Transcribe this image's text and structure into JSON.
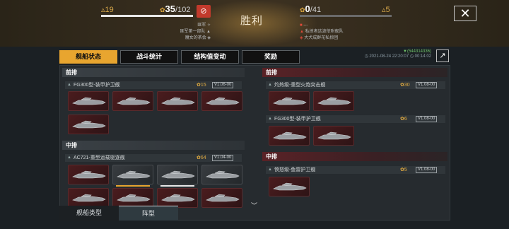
{
  "header": {
    "left_level": "19",
    "left_score": "35",
    "left_score_total": "/102",
    "right_score": "0",
    "right_score_total": "/41",
    "right_level": "5",
    "result": "胜利",
    "left_notes": [
      "匪军",
      "匪军第一部队",
      "魔女的茶会"
    ],
    "right_notes": [
      "---",
      "私掠者这波依附舰队",
      "大犬成群花私掠团"
    ]
  },
  "tabs": [
    "舰船状态",
    "战斗统计",
    "结构值变动",
    "奖励"
  ],
  "meta": {
    "id": "(544314336)",
    "time": "2021-08-24 22:20:07",
    "duration": "00:14:02"
  },
  "left": {
    "section1": "前排",
    "ship1": {
      "name": "FG300型-装甲护卫舰",
      "score": "15",
      "ver": "V1.06-00"
    },
    "section2": "中排",
    "ship2": {
      "name": "AC721-重型运载驱逐舰",
      "score": "64",
      "ver": "V1.04-00"
    }
  },
  "right": {
    "section1": "前排",
    "ship1": {
      "name": "灼热级-重型火炮突击舰",
      "score": "30",
      "ver": "V1.08-00"
    },
    "ship2": {
      "name": "FG300型-装甲护卫舰",
      "score": "6",
      "ver": "V1.08-00"
    },
    "section2": "中排",
    "ship3": {
      "name": "愤怒级-鱼雷护卫舰",
      "score": "5",
      "ver": "V1.08-00"
    }
  },
  "bottom_tabs": [
    "舰船类型",
    "阵型"
  ],
  "colors": {
    "accent": "#e8a52f",
    "enemy": "#c23a2c"
  }
}
